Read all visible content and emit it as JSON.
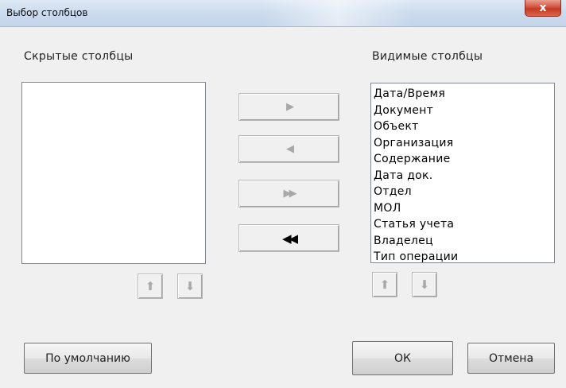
{
  "window": {
    "title": "Выбор столбцов",
    "close_glyph": "x"
  },
  "hidden": {
    "label": "Скрытые столбцы",
    "items": []
  },
  "visible": {
    "label": "Видимые столбцы",
    "items": [
      "Дата/Время",
      "Документ",
      "Объект",
      "Организация",
      "Содержание",
      "Дата док.",
      "Отдел",
      "МОЛ",
      "Статья учета",
      "Владелец",
      "Тип операции"
    ]
  },
  "transfer": {
    "move_right_glyph": "▶",
    "move_left_glyph": "◀",
    "move_all_right_glyph": "▶▶",
    "move_all_left_glyph": "◀◀"
  },
  "order": {
    "up_glyph": "⬆",
    "down_glyph": "⬇"
  },
  "footer": {
    "default_label": "По умолчанию",
    "ok_label": "ОК",
    "cancel_label": "Отмена"
  }
}
